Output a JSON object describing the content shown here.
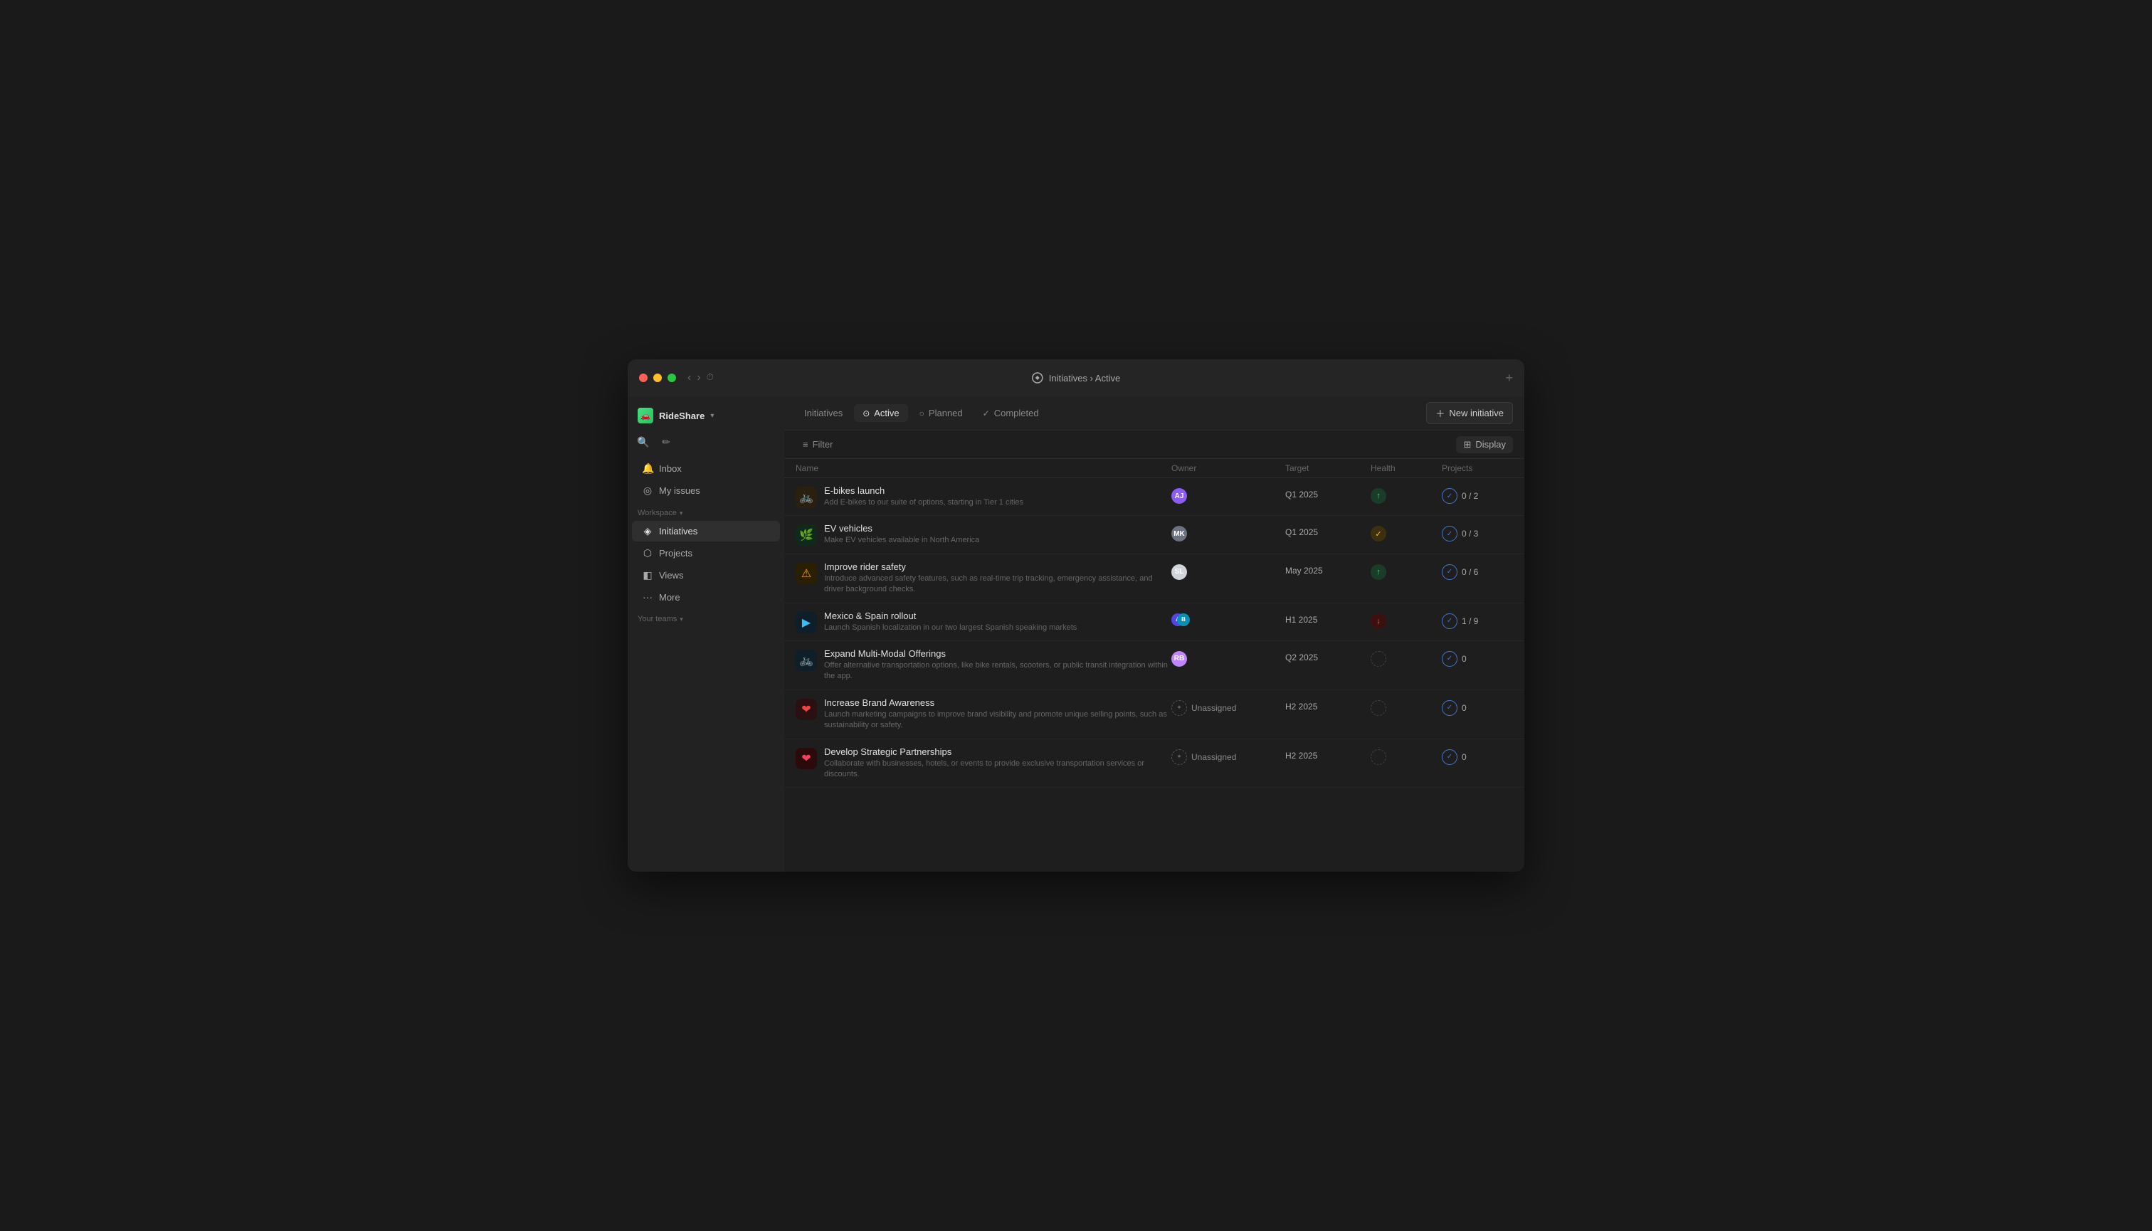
{
  "window": {
    "titlebar": {
      "title": "Initiatives › Active",
      "back_label": "‹",
      "forward_label": "›",
      "clock_label": "⏱",
      "add_label": "+"
    }
  },
  "sidebar": {
    "workspace": {
      "name": "RideShare",
      "caret": "▾"
    },
    "nav_items": [
      {
        "id": "inbox",
        "label": "Inbox",
        "icon": "🔔"
      },
      {
        "id": "my-issues",
        "label": "My issues",
        "icon": "◎"
      }
    ],
    "section_workspace": "Workspace",
    "workspace_items": [
      {
        "id": "initiatives",
        "label": "Initiatives",
        "icon": "◈",
        "active": true
      },
      {
        "id": "projects",
        "label": "Projects",
        "icon": "⬡"
      },
      {
        "id": "views",
        "label": "Views",
        "icon": "◧"
      }
    ],
    "more_label": "More",
    "your_teams_label": "Your teams"
  },
  "content": {
    "tabs": [
      {
        "id": "initiatives",
        "label": "Initiatives",
        "icon": ""
      },
      {
        "id": "active",
        "label": "Active",
        "icon": "⊙",
        "active": true
      },
      {
        "id": "planned",
        "label": "Planned",
        "icon": "○"
      },
      {
        "id": "completed",
        "label": "Completed",
        "icon": "✓"
      }
    ],
    "new_initiative_label": "New initiative",
    "filter_label": "Filter",
    "display_label": "Display",
    "table_headers": {
      "name": "Name",
      "owner": "Owner",
      "target": "Target",
      "health": "Health",
      "projects": "Projects"
    },
    "initiatives": [
      {
        "id": 1,
        "icon": "🚲",
        "icon_bg": "#2a2010",
        "title": "E-bikes launch",
        "description": "Add E-bikes to our suite of options, starting in Tier 1 cities",
        "owner_type": "avatar",
        "owner_color": "#8b5cf6",
        "owner_initials": "AJ",
        "owner_label": "",
        "target": "Q1 2025",
        "health": "green",
        "projects_badge": "0 / 2"
      },
      {
        "id": 2,
        "icon": "🌿",
        "icon_bg": "#0f2a1a",
        "title": "EV vehicles",
        "description": "Make EV vehicles available in North America",
        "owner_type": "avatar",
        "owner_color": "#6b7280",
        "owner_initials": "MK",
        "owner_label": "",
        "target": "Q1 2025",
        "health": "yellow",
        "projects_badge": "0 / 3"
      },
      {
        "id": 3,
        "icon": "⚠",
        "icon_bg": "#2a1f00",
        "title": "Improve rider safety",
        "description": "Introduce advanced safety features, such as real-time trip tracking, emergency assistance, and driver background checks.",
        "owner_type": "avatar",
        "owner_color": "#d1d5db",
        "owner_initials": "SL",
        "owner_label": "",
        "target": "May 2025",
        "health": "green",
        "projects_badge": "0 / 6"
      },
      {
        "id": 4,
        "icon": "▶",
        "icon_bg": "#0f1f2a",
        "title": "Mexico & Spain rollout",
        "description": "Launch Spanish localization in our two largest Spanish speaking markets",
        "owner_type": "multi",
        "owner_label": "",
        "target": "H1 2025",
        "health": "red",
        "projects_badge": "1 / 9"
      },
      {
        "id": 5,
        "icon": "🚲",
        "icon_bg": "#0f1f2a",
        "title": "Expand Multi-Modal Offerings",
        "description": "Offer alternative transportation options, like bike rentals, scooters, or public transit integration within the app.",
        "owner_type": "avatar",
        "owner_color": "#c084fc",
        "owner_initials": "RB",
        "owner_label": "",
        "target": "Q2 2025",
        "health": "empty",
        "projects_badge": "0"
      },
      {
        "id": 6,
        "icon": "❤",
        "icon_bg": "#2a1010",
        "title": "Increase Brand Awareness",
        "description": "Launch marketing campaigns to improve brand visibility and promote unique selling points, such as sustainability or safety.",
        "owner_type": "unassigned",
        "owner_label": "Unassigned",
        "target": "H2 2025",
        "health": "empty",
        "projects_badge": "0"
      },
      {
        "id": 7,
        "icon": "❤",
        "icon_bg": "#2a0a0a",
        "title": "Develop Strategic Partnerships",
        "description": "Collaborate with businesses, hotels, or events to provide exclusive transportation services or discounts.",
        "owner_type": "unassigned",
        "owner_label": "Unassigned",
        "target": "H2 2025",
        "health": "empty",
        "projects_badge": "0"
      }
    ]
  }
}
